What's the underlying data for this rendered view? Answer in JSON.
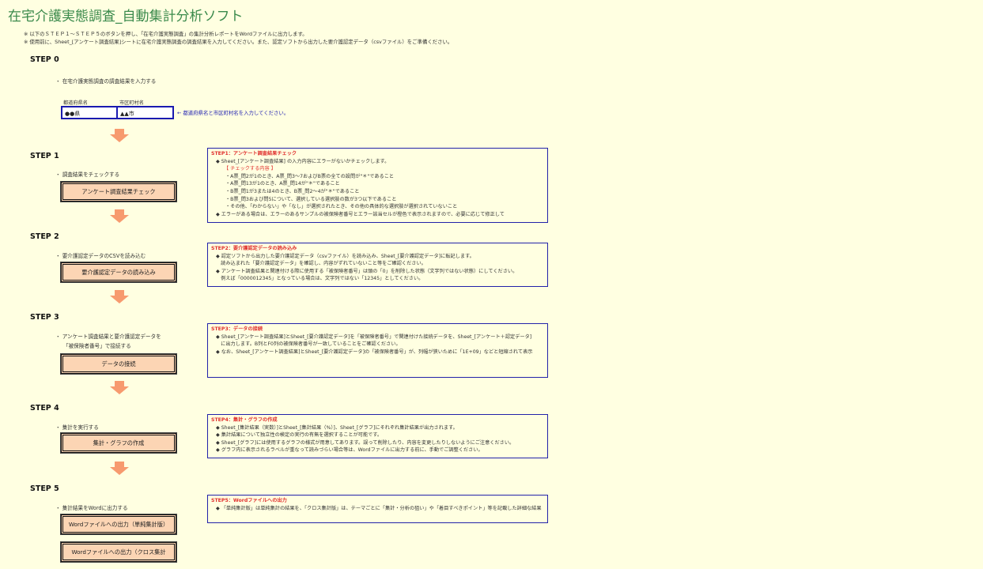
{
  "title": "在宅介護実態調査_自動集計分析ソフト",
  "notes": [
    "※ 以下のＳＴＥＰ１～ＳＴＥＰ５のボタンを押し、「在宅介護実態調査」の集計分析レポートをWordファイルに出力します。",
    "※ 使用前に、Sheet_[アンケート調査結果]シートに在宅介護実態調査の調査結果を入力してください。また、認定ソフトから出力した要介護認定データ（csvファイル）をご準備ください。"
  ],
  "step0": {
    "label": "STEP 0",
    "desc": "・ 在宅介護実態調査の調査結果を入力する",
    "pref_label": "都道府県名",
    "city_label": "市区町村名",
    "pref_value": "●●県",
    "city_value": "▲▲市",
    "hint": "← 都道府県名と市区町村名を入力してください。"
  },
  "step1": {
    "label": "STEP 1",
    "desc": "・ 調査結果をチェックする",
    "button": "アンケート調査結果チェック",
    "info_title": "STEP1：アンケート調査結果チェック",
    "lines": [
      "◆ Sheet_[アンケート調査結果] の入力内容にエラーがないかチェックします。",
      "【 チェックする内容 】",
      "・A票_問2が1のとき、A票_問3～7およびB票の全ての設問が\"＊\"であること",
      "・A票_問13が1のとき、A票_問14が\"＊\"であること",
      "・B票_問1が3または4のとき、B票_問2～4が\"＊\"であること",
      "・B票_問3および問5について、選択している選択肢の数が3つ以下であること",
      "・その他、「わからない」や「なし」が選択されたとき、その他の具体的な選択肢が選択されていないこと",
      "◆ エラーがある場合は、エラーのあるサンプルの被保険者番号とエラー該当セルが橙色で表示されますので、必要に応じて修正して"
    ]
  },
  "step2": {
    "label": "STEP 2",
    "desc": "・ 要介護認定データのCSVを読み込む",
    "button": "要介護認定データの読み込み",
    "info_title": "STEP2：要介護認定データの読み込み",
    "lines": [
      "◆ 認定ソフトから出力した要介護認定データ（csvファイル）を読み込み、Sheet_[要介護認定データ]に転記します。",
      "　読み込まれた「要介護認定データ」を確認し、内容がずれていないこと等をご確認ください。",
      "◆ アンケート調査結果と関連付ける際に使用する「被保険者番号」は頭の「0」を削除した状態（文字列ではない状態）にしてください。",
      "　例えば「0000012345」となっている場合は、文字列ではない「12345」としてください。"
    ]
  },
  "step3": {
    "label": "STEP 3",
    "desc1": "・ アンケート調査結果と要介護認定データを",
    "desc2": "「被保険者番号」で接続する",
    "button": "データの接続",
    "info_title": "STEP3：データの接続",
    "lines": [
      "◆ Sheet_[アンケート調査結果]とSheet_[要介護認定データ]を「被保険者番号」で関連付けた接続データを、Sheet_[アンケート＋認定データ]",
      "　に出力します。B列とF0列の被保険者番号が一致していることをご確認ください。",
      "◆ なお、Sheet_[アンケート調査結果]とSheet_[要介護認定データ]の「被保険者番号」が、列幅が狭いために「1E+09」などと短縮されて表示"
    ]
  },
  "step4": {
    "label": "STEP 4",
    "desc": "・ 集計を実行する",
    "button": "集計・グラフの作成",
    "info_title": "STEP4：集計・グラフの作成",
    "lines": [
      "◆ Sheet_[集計結果（実数）]とSheet_[集計結果（%）]、Sheet_[グラフ]にそれぞれ集計結果が出力されます。",
      "◆ 集計結果について独立性の検定の実行の有無を選択することが可能です。",
      "◆ Sheet_[グラフ]には使用するグラフの様式が用意してあります。誤って削除したり、内容を変更したりしないようにご注意ください。",
      "◆ グラフ内に表示されるラベルが重なって読みづらい場合等は、Wordファイルに出力する前に、手動でご調整ください。"
    ]
  },
  "step5": {
    "label": "STEP 5",
    "desc": "・ 集計結果をWordに出力する",
    "button1": "Wordファイルへの出力（単純集計版）",
    "button2": "Wordファイルへの出力（クロス集計",
    "info_title": "STEP5：Wordファイルへの出力",
    "lines": [
      "◆ 「単純集計版」は単純集計の結果を、「クロス集計版」は、テーマごとに「集計・分析の狙い」や「着目すべきポイント」等を記載した詳細な結果"
    ]
  },
  "colors": {
    "title": "#3b8a4c",
    "button_fill": "#fcd5b4",
    "arrow": "#f79a6e",
    "info_border": "#2222aa",
    "info_title": "#e0302e",
    "background": "#ffffe1"
  },
  "icons": {
    "arrow": "down-arrow-icon"
  }
}
